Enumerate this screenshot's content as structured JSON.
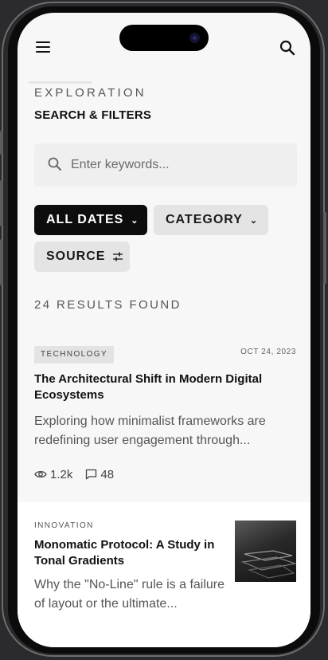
{
  "header": {
    "eyebrow": "EXPLORATION",
    "title": "SEARCH & FILTERS",
    "menu_icon": "hamburger-menu-icon",
    "search_icon": "search-icon"
  },
  "search": {
    "placeholder": "Enter keywords...",
    "value": ""
  },
  "filters": {
    "dates_label": "ALL DATES",
    "category_label": "CATEGORY",
    "source_label": "SOURCE"
  },
  "results": {
    "count_text": "24 RESULTS FOUND"
  },
  "articles": [
    {
      "tag": "TECHNOLOGY",
      "date": "OCT 24, 2023",
      "title": "The Architectural Shift in Modern Digital Ecosystems",
      "excerpt": "Exploring how minimalist frameworks are redefining user engagement through...",
      "views": "1.2k",
      "comments": "48"
    },
    {
      "tag": "INNOVATION",
      "title": "Monomatic Protocol: A Study in Tonal Gradients",
      "excerpt": "Why the \"No-Line\" rule is a failure of layout or the ultimate..."
    }
  ],
  "colors": {
    "background": "#f7f7f7",
    "chip_active": "#0d0d0d",
    "chip_inactive": "#e4e4e4",
    "text_primary": "#111111",
    "text_secondary": "#555555"
  }
}
